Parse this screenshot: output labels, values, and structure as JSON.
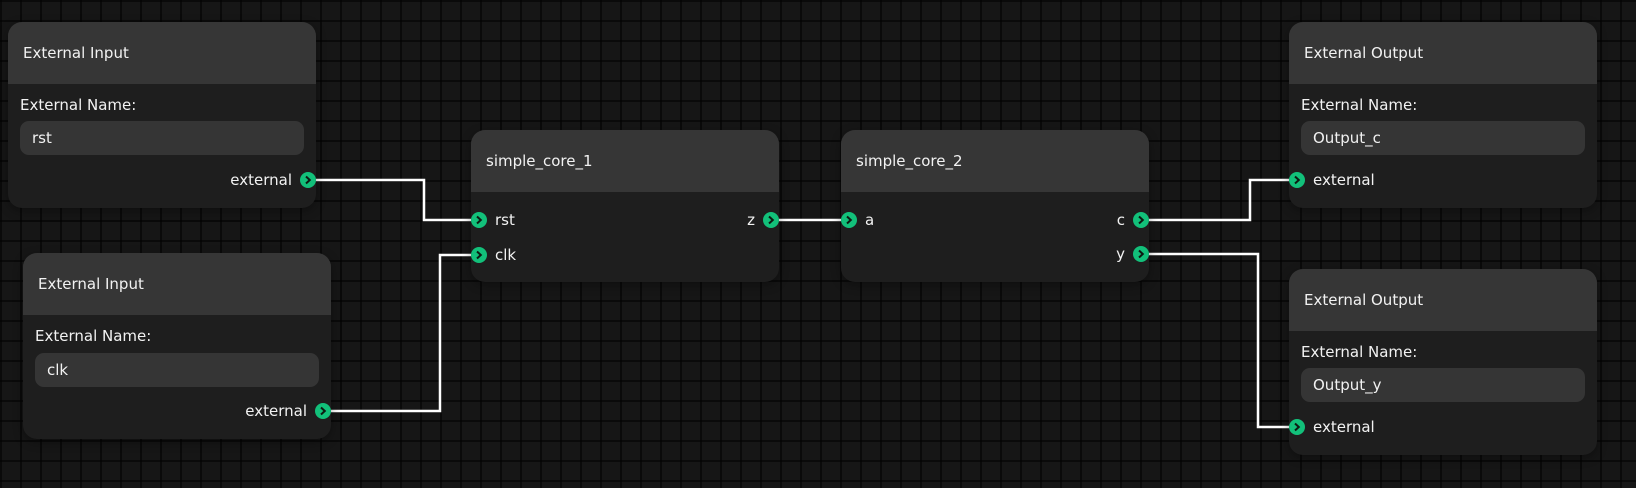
{
  "colors": {
    "wire": "#ffffff",
    "port": "#12c07a",
    "header": "#363636",
    "body": "#1e1e1e"
  },
  "nodes": {
    "input_rst": {
      "title": "External Input",
      "field_label": "External Name:",
      "field_value": "rst",
      "port_label": "external"
    },
    "input_clk": {
      "title": "External Input",
      "field_label": "External Name:",
      "field_value": "clk",
      "port_label": "external"
    },
    "core_1": {
      "title": "simple_core_1",
      "inputs": [
        "rst",
        "clk"
      ],
      "outputs": [
        "z"
      ]
    },
    "core_2": {
      "title": "simple_core_2",
      "inputs": [
        "a"
      ],
      "outputs": [
        "c",
        "y"
      ]
    },
    "output_c": {
      "title": "External Output",
      "field_label": "External Name:",
      "field_value": "Output_c",
      "port_label": "external"
    },
    "output_y": {
      "title": "External Output",
      "field_label": "External Name:",
      "field_value": "Output_y",
      "port_label": "external"
    }
  },
  "connections": [
    {
      "from": "input_rst.external",
      "to": "core_1.rst"
    },
    {
      "from": "input_clk.external",
      "to": "core_1.clk"
    },
    {
      "from": "core_1.z",
      "to": "core_2.a"
    },
    {
      "from": "core_2.c",
      "to": "output_c.external"
    },
    {
      "from": "core_2.y",
      "to": "output_y.external"
    }
  ]
}
